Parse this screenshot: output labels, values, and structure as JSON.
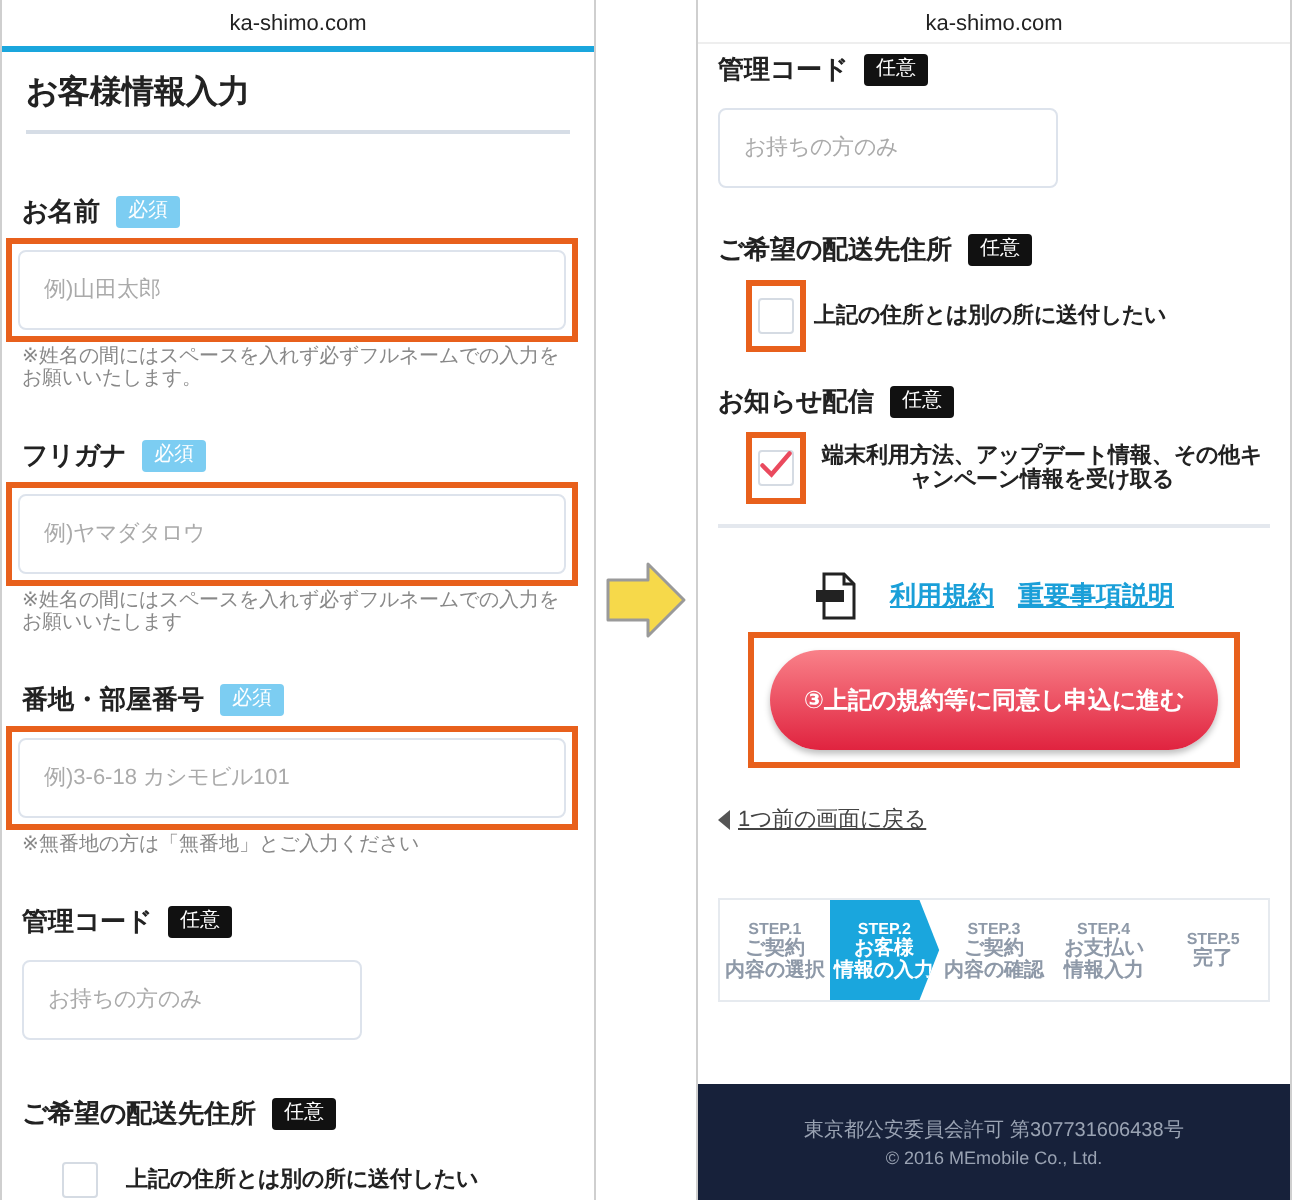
{
  "phones": [
    {
      "url": "ka-shimo.com",
      "items": [
        {
          "kind": "heading",
          "text": "お客様情報入力"
        },
        {
          "kind": "field",
          "label": "お名前",
          "badge": {
            "text": "必須",
            "kind": "required"
          },
          "placeholder": "例)山田太郎",
          "highlighted": true,
          "note": "※姓名の間にはスペースを入れず必ずフルネームでの入力をお願いいたします。"
        },
        {
          "kind": "field",
          "label": "フリガナ",
          "badge": {
            "text": "必須",
            "kind": "required"
          },
          "placeholder": "例)ヤマダタロウ",
          "highlighted": true,
          "note": "※姓名の間にはスペースを入れず必ずフルネームでの入力をお願いいたします"
        },
        {
          "kind": "break"
        },
        {
          "kind": "field",
          "label": "番地・部屋番号",
          "badge": {
            "text": "必須",
            "kind": "required"
          },
          "placeholder": "例)3-6-18 カシモビル101",
          "highlighted": true,
          "note": "※無番地の方は「無番地」とご入力ください"
        },
        {
          "kind": "short_field",
          "label": "管理コード",
          "badge": {
            "text": "任意",
            "kind": "optional"
          },
          "placeholder": "お持ちの方のみ",
          "highlighted": false
        },
        {
          "kind": "checkbox_group",
          "label": "ご希望の配送先住所",
          "badge": {
            "text": "任意",
            "kind": "optional"
          },
          "options": [
            {
              "text": "上記の住所とは別の所に送付したい",
              "checked": false,
              "highlighted": false
            }
          ]
        }
      ]
    },
    {
      "url": "ka-shimo.com",
      "items": [
        {
          "kind": "short_field",
          "label": "管理コード",
          "badge": {
            "text": "任意",
            "kind": "optional"
          },
          "placeholder": "お持ちの方のみ",
          "highlighted": false
        },
        {
          "kind": "checkbox_group",
          "label": "ご希望の配送先住所",
          "badge": {
            "text": "任意",
            "kind": "optional"
          },
          "options": [
            {
              "text": "上記の住所とは別の所に送付したい",
              "checked": false,
              "highlighted": true
            }
          ]
        },
        {
          "kind": "checkbox_group",
          "label": "お知らせ配信",
          "badge": {
            "text": "任意",
            "kind": "optional"
          },
          "options": [
            {
              "text": "端末利用方法、アップデート情報、その他キャンペーン情報を受け取る",
              "checked": true,
              "highlighted": true
            }
          ]
        },
        {
          "kind": "divider"
        },
        {
          "kind": "doc_links",
          "links": [
            "利用規約",
            "重要事項説明"
          ]
        },
        {
          "kind": "submit",
          "text": "③上記の規約等に同意し申込に進む",
          "highlighted": true
        },
        {
          "kind": "back_link",
          "text": "1つ前の画面に戻る"
        },
        {
          "kind": "steps",
          "steps": [
            {
              "number": "STEP.1",
              "lines": [
                "ご契約",
                "内容の選択"
              ],
              "selected": false
            },
            {
              "number": "STEP.2",
              "lines": [
                "お客様",
                "情報の入力"
              ],
              "selected": true
            },
            {
              "number": "STEP.3",
              "lines": [
                "ご契約",
                "内容の確認"
              ],
              "selected": false
            },
            {
              "number": "STEP.4",
              "lines": [
                "お支払い",
                "情報入力"
              ],
              "selected": false
            },
            {
              "number": "STEP.5",
              "lines": [
                "完了"
              ],
              "selected": false
            }
          ]
        },
        {
          "kind": "footer",
          "license": "東京都公安委員会許可 第307731606438号",
          "copyright": "© 2016 MEmobile Co., Ltd."
        }
      ]
    }
  ]
}
